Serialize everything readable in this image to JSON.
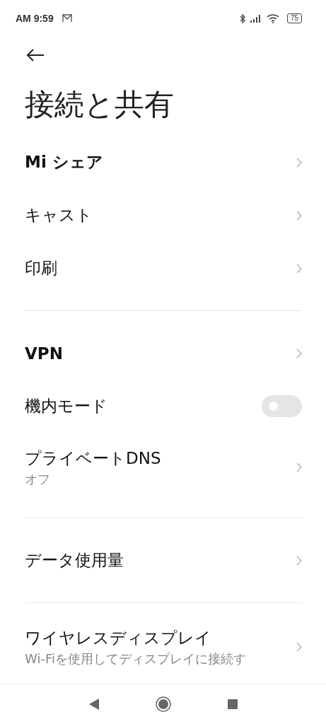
{
  "status_bar": {
    "time": "AM 9:59",
    "battery": "75"
  },
  "title": "接続と共有",
  "sections": [
    {
      "items": [
        {
          "kind": "link",
          "label": "Mi シェア",
          "emphasis": true
        },
        {
          "kind": "link",
          "label": "キャスト",
          "emphasis": false
        },
        {
          "kind": "link",
          "label": "印刷",
          "emphasis": false
        }
      ]
    },
    {
      "items": [
        {
          "kind": "link",
          "label": "VPN",
          "emphasis": true
        },
        {
          "kind": "toggle",
          "label": "機内モード",
          "emphasis": false,
          "on": false
        },
        {
          "kind": "link",
          "label": "プライベートDNS",
          "emphasis": false,
          "subtitle": "オフ"
        }
      ]
    },
    {
      "items": [
        {
          "kind": "link",
          "label": "データ使用量",
          "emphasis": false
        }
      ]
    },
    {
      "items": [
        {
          "kind": "link",
          "label": "ワイヤレスディスプレイ",
          "emphasis": false,
          "subtitle": "Wi-Fiを使用してディスプレイに接続す"
        }
      ]
    }
  ]
}
